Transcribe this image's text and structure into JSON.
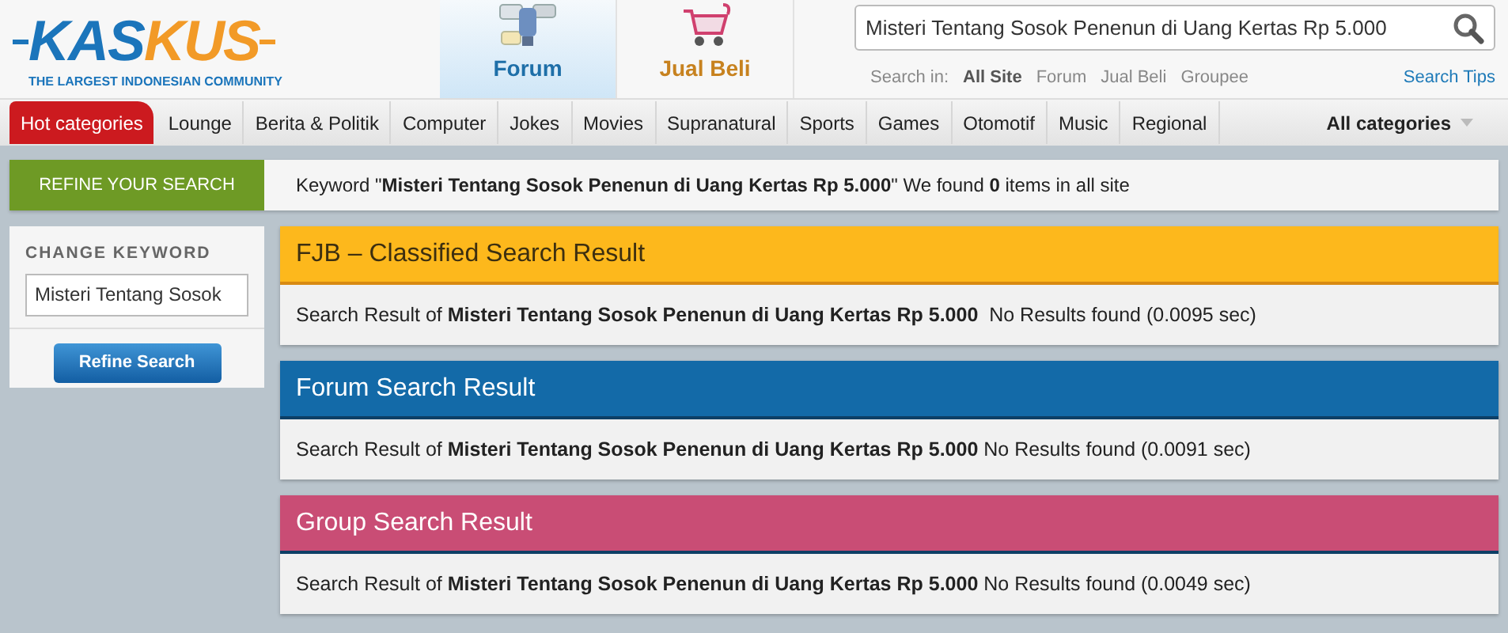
{
  "logo": {
    "part1": "KAS",
    "part2": "KUS",
    "tagline": "THE LARGEST INDONESIAN COMMUNITY"
  },
  "tabs": [
    {
      "label": "Forum",
      "kind": "forum",
      "selected": true
    },
    {
      "label": "Jual Beli",
      "kind": "cart",
      "selected": false
    }
  ],
  "search": {
    "value": "Misteri Tentang Sosok Penenun di Uang Kertas Rp 5.000",
    "scope_label": "Search in:",
    "scopes": [
      {
        "label": "All Site",
        "selected": true
      },
      {
        "label": "Forum",
        "selected": false
      },
      {
        "label": "Jual Beli",
        "selected": false
      },
      {
        "label": "Groupee",
        "selected": false
      }
    ],
    "tips": "Search Tips"
  },
  "nav": {
    "items": [
      {
        "label": "Hot categories",
        "selected": true
      },
      {
        "label": "Lounge",
        "selected": false
      },
      {
        "label": "Berita & Politik",
        "selected": false
      },
      {
        "label": "Computer",
        "selected": false
      },
      {
        "label": "Jokes",
        "selected": false
      },
      {
        "label": "Movies",
        "selected": false
      },
      {
        "label": "Supranatural",
        "selected": false
      },
      {
        "label": "Sports",
        "selected": false
      },
      {
        "label": "Games",
        "selected": false
      },
      {
        "label": "Otomotif",
        "selected": false
      },
      {
        "label": "Music",
        "selected": false
      },
      {
        "label": "Regional",
        "selected": false
      }
    ],
    "all": "All categories"
  },
  "refine": {
    "title": "REFINE YOUR SEARCH",
    "summary": "Keyword \"**Misteri Tentang Sosok Penenun di Uang Kertas Rp 5.000**\" We found **0** items in all site"
  },
  "sidebar": {
    "heading": "CHANGE KEYWORD",
    "value": "Misteri Tentang Sosok",
    "button": "Refine Search"
  },
  "results": [
    {
      "title": "FJB – Classified Search Result",
      "kind": "light",
      "color": "#fdb81c",
      "text": "Search Result of **Misteri Tentang Sosok Penenun di Uang Kertas Rp 5.000**  No Results found (0.0095 sec)"
    },
    {
      "title": "Forum Search Result",
      "kind": "dark",
      "color": "#136aa8",
      "text": "Search Result of **Misteri Tentang Sosok Penenun di Uang Kertas Rp 5.000** No Results found (0.0091 sec)"
    },
    {
      "title": "Group Search Result",
      "kind": "dark",
      "color": "#c94d75",
      "text": "Search Result of **Misteri Tentang Sosok Penenun di Uang Kertas Rp 5.000** No Results found (0.0049 sec)"
    }
  ]
}
